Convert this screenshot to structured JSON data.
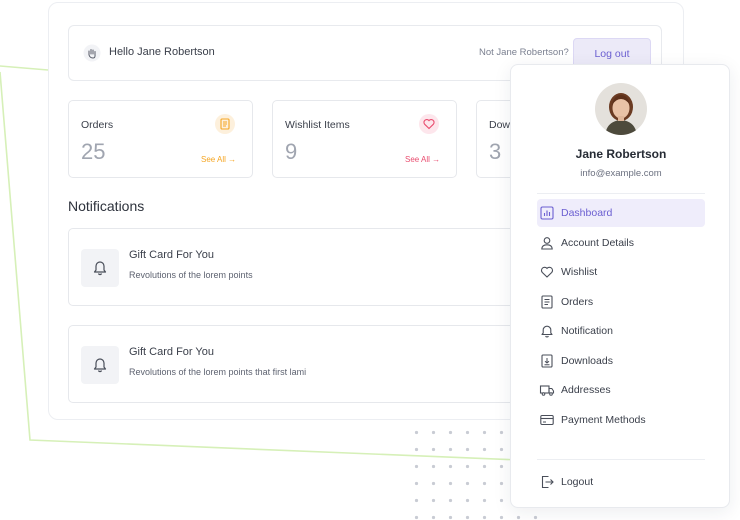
{
  "header": {
    "greeting": "Hello Jane Robertson",
    "not_user": "Not Jane Robertson?",
    "logout_label": "Log out"
  },
  "stats": [
    {
      "label": "Orders",
      "value": "25",
      "link": "See All →",
      "icon": "list-icon",
      "accent": "#f5a623"
    },
    {
      "label": "Wishlist Items",
      "value": "9",
      "link": "See All →",
      "icon": "heart-icon",
      "accent": "#e94d6f"
    },
    {
      "label": "Dow",
      "value": "3",
      "link": "",
      "icon": "download-icon",
      "accent": "#6b5fd1"
    }
  ],
  "notifications": {
    "title": "Notifications",
    "items": [
      {
        "title": "Gift Card For You",
        "text": "Revolutions of the lorem points"
      },
      {
        "title": "Gift Card For You",
        "text": "Revolutions of the lorem points that first lami"
      }
    ]
  },
  "profile": {
    "name": "Jane Robertson",
    "email": "info@example.com",
    "menu": [
      {
        "label": "Dashboard",
        "icon": "chart-icon",
        "active": true
      },
      {
        "label": "Account Details",
        "icon": "user-icon",
        "active": false
      },
      {
        "label": "Wishlist",
        "icon": "heart-icon",
        "active": false
      },
      {
        "label": "Orders",
        "icon": "document-icon",
        "active": false
      },
      {
        "label": "Notification",
        "icon": "bell-icon",
        "active": false
      },
      {
        "label": "Downloads",
        "icon": "download-icon",
        "active": false
      },
      {
        "label": "Addresses",
        "icon": "truck-icon",
        "active": false
      },
      {
        "label": "Payment Methods",
        "icon": "card-icon",
        "active": false
      }
    ],
    "logout_label": "Logout"
  },
  "colors": {
    "accent": "#6b5fd1",
    "accent_bg": "#efedfb",
    "decor_line": "#d6f0b8"
  }
}
